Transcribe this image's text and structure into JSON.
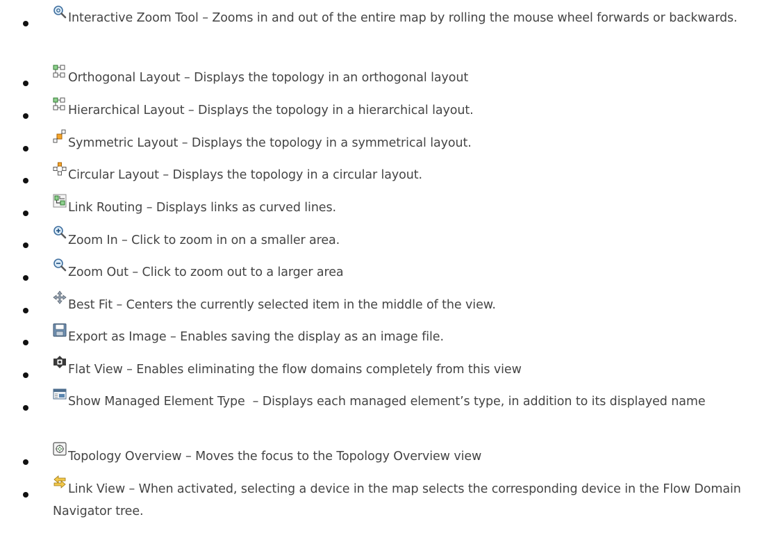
{
  "items": [
    {
      "icon": "zoom-magnifier-icon",
      "label": "Interactive Zoom Tool",
      "sep": " – ",
      "desc": "Zooms in and out of the entire map by rolling the mouse wheel forwards or backwards."
    },
    {
      "icon": "orthogonal-layout-icon",
      "label": "Orthogonal Layout",
      "sep": " – ",
      "desc": "Displays the topology in an orthogonal layout"
    },
    {
      "icon": "hierarchical-layout-icon",
      "label": "Hierarchical Layout",
      "sep": " – ",
      "desc": "Displays the topology in a hierarchical layout."
    },
    {
      "icon": "symmetric-layout-icon",
      "label": "Symmetric Layout",
      "sep": " – ",
      "desc": "Displays the topology in a symmetrical layout."
    },
    {
      "icon": "circular-layout-icon",
      "label": "Circular Layout",
      "sep": " – ",
      "desc": "Displays the topology in a circular layout."
    },
    {
      "icon": "link-routing-icon",
      "label": "Link Routing",
      "sep": " – ",
      "desc": "Displays links as curved lines."
    },
    {
      "icon": "zoom-in-icon",
      "label": "Zoom In",
      "sep": " – ",
      "desc": "Click to zoom in on a smaller area."
    },
    {
      "icon": "zoom-out-icon",
      "label": "Zoom Out",
      "sep": " – ",
      "desc": "Click to zoom out to a larger area"
    },
    {
      "icon": "best-fit-icon",
      "label": "Best Fit",
      "sep": " – ",
      "desc": "Centers the currently selected item in the middle of the view."
    },
    {
      "icon": "save-floppy-icon",
      "label": "Export as Image",
      "sep": " – ",
      "desc": "Enables saving the display as an image file."
    },
    {
      "icon": "flat-view-icon",
      "label": "Flat View",
      "sep": " – ",
      "desc": "Enables eliminating the flow domains completely from this view"
    },
    {
      "icon": "managed-element-type-icon",
      "label": "Show Managed Element Type",
      "sep": "  – ",
      "desc": "Displays each managed element’s type, in addition to its displayed name"
    },
    {
      "icon": "topology-overview-icon",
      "label": "Topology Overview",
      "sep": " – ",
      "desc": "Moves the focus to the Topology Overview view"
    },
    {
      "icon": "link-view-arrows-icon",
      "label": "Link View",
      "sep": " – ",
      "desc": "When activated, selecting a device in the map selects the corresponding device in the Flow Domain Navigator tree."
    }
  ]
}
